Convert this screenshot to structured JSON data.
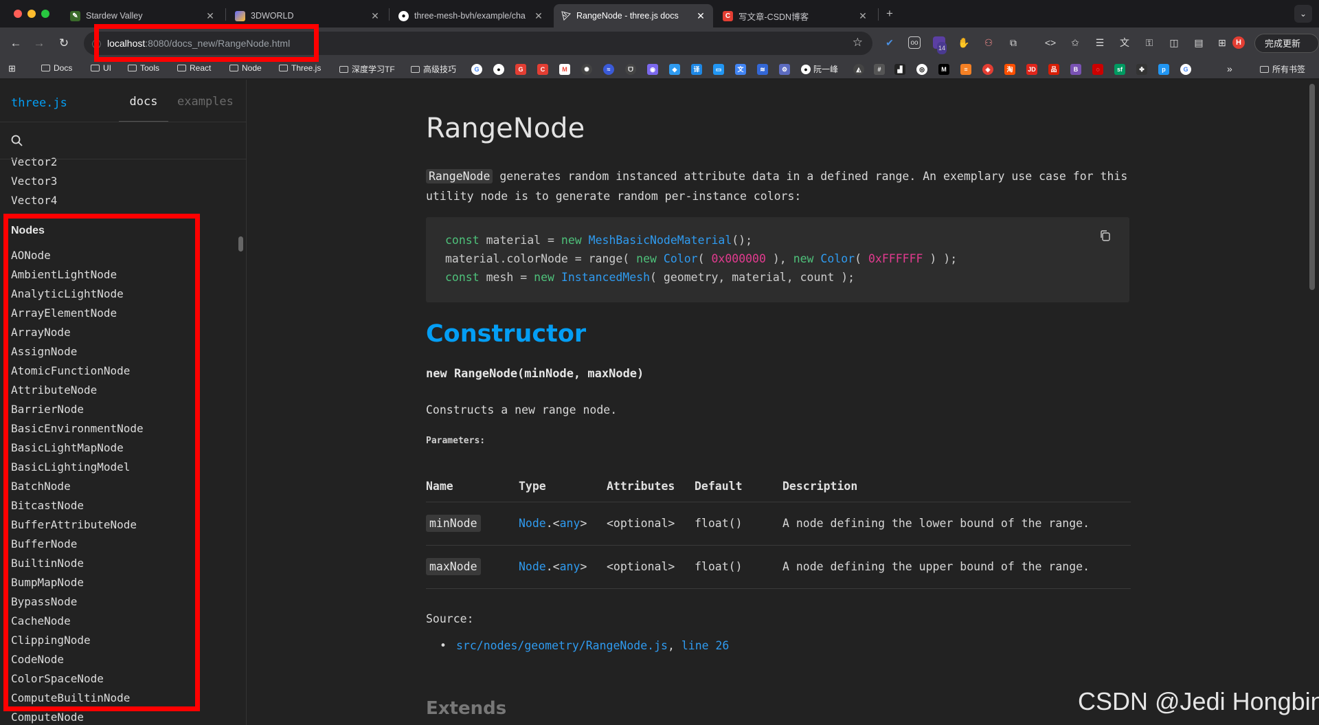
{
  "browser": {
    "tabs": [
      {
        "title": "Stardew Valley",
        "favicon": "stardew-icon",
        "active": false
      },
      {
        "title": "3DWORLD",
        "favicon": "vite-icon",
        "active": false
      },
      {
        "title": "three-mesh-bvh/example/cha",
        "favicon": "github-icon",
        "active": false
      },
      {
        "title": "RangeNode - three.js docs",
        "favicon": "threejs-icon",
        "active": true
      },
      {
        "title": "写文章-CSDN博客",
        "favicon": "csdn-icon",
        "active": false
      }
    ],
    "address": {
      "host": "localhost",
      "path": ":8080/docs_new/RangeNode.html"
    },
    "update_button": "完成更新",
    "profile_initial": "H",
    "extension_badge": "14",
    "bookmarks": [
      "Docs",
      "UI",
      "Tools",
      "React",
      "Node",
      "Three.js",
      "深度学习TF",
      "高级技巧"
    ],
    "bookmark_person": "阮一峰",
    "all_bookmarks": "所有书签"
  },
  "sidebar": {
    "logo": "three.js",
    "tab_docs": "docs",
    "tab_examples": "examples",
    "items_before": [
      "Vector2",
      "Vector3",
      "Vector4"
    ],
    "section": "Nodes",
    "items": [
      "AONode",
      "AmbientLightNode",
      "AnalyticLightNode",
      "ArrayElementNode",
      "ArrayNode",
      "AssignNode",
      "AtomicFunctionNode",
      "AttributeNode",
      "BarrierNode",
      "BasicEnvironmentNode",
      "BasicLightMapNode",
      "BasicLightingModel",
      "BatchNode",
      "BitcastNode",
      "BufferAttributeNode",
      "BufferNode",
      "BuiltinNode",
      "BumpMapNode",
      "BypassNode",
      "CacheNode",
      "ClippingNode",
      "CodeNode",
      "ColorSpaceNode",
      "ComputeBuiltinNode",
      "ComputeNode"
    ]
  },
  "content": {
    "title": "RangeNode",
    "intro_code": "RangeNode",
    "intro_text": " generates random instanced attribute data in a defined range. An exemplary use case for this utility node is to generate random per-instance colors:",
    "code": {
      "l1_kw": "const",
      "l1_a": " material = ",
      "l1_new": "new",
      "l1_cls": " MeshBasicNodeMaterial",
      "l1_b": "();",
      "l2_a": "material.colorNode = range( ",
      "l2_new1": "new",
      "l2_cls1": " Color",
      "l2_b": "( ",
      "l2_num1": "0x000000",
      "l2_c": " ), ",
      "l2_new2": "new",
      "l2_cls2": " Color",
      "l2_d": "( ",
      "l2_num2": "0xFFFFFF",
      "l2_e": " ) );",
      "l3_kw": "const",
      "l3_a": " mesh = ",
      "l3_new": "new",
      "l3_cls": " InstancedMesh",
      "l3_b": "( geometry, material, count );"
    },
    "constructor_heading": "Constructor",
    "signature": "new RangeNode(minNode, maxNode)",
    "constructor_desc": "Constructs a new range node.",
    "params_label": "Parameters:",
    "table": {
      "headers": [
        "Name",
        "Type",
        "Attributes",
        "Default",
        "Description"
      ],
      "rows": [
        {
          "name": "minNode",
          "type": "Node",
          "type_sep": ".<",
          "type_generic": "any",
          "type_end": ">",
          "attributes": "<optional>",
          "default": "float()",
          "description": "A node defining the lower bound of the range."
        },
        {
          "name": "maxNode",
          "type": "Node",
          "type_sep": ".<",
          "type_generic": "any",
          "type_end": ">",
          "attributes": "<optional>",
          "default": "float()",
          "description": "A node defining the upper bound of the range."
        }
      ]
    },
    "source_label": "Source:",
    "source_file": "src/nodes/geometry/RangeNode.js",
    "source_sep": ", ",
    "source_line": "line 26",
    "extends_heading": "Extends"
  },
  "watermark": "CSDN @Jedi Hongbin",
  "colors": {
    "accent": "#049ef4",
    "highlight": "#ff0000",
    "keyword": "#4ec17a",
    "number": "#e23b8f"
  }
}
